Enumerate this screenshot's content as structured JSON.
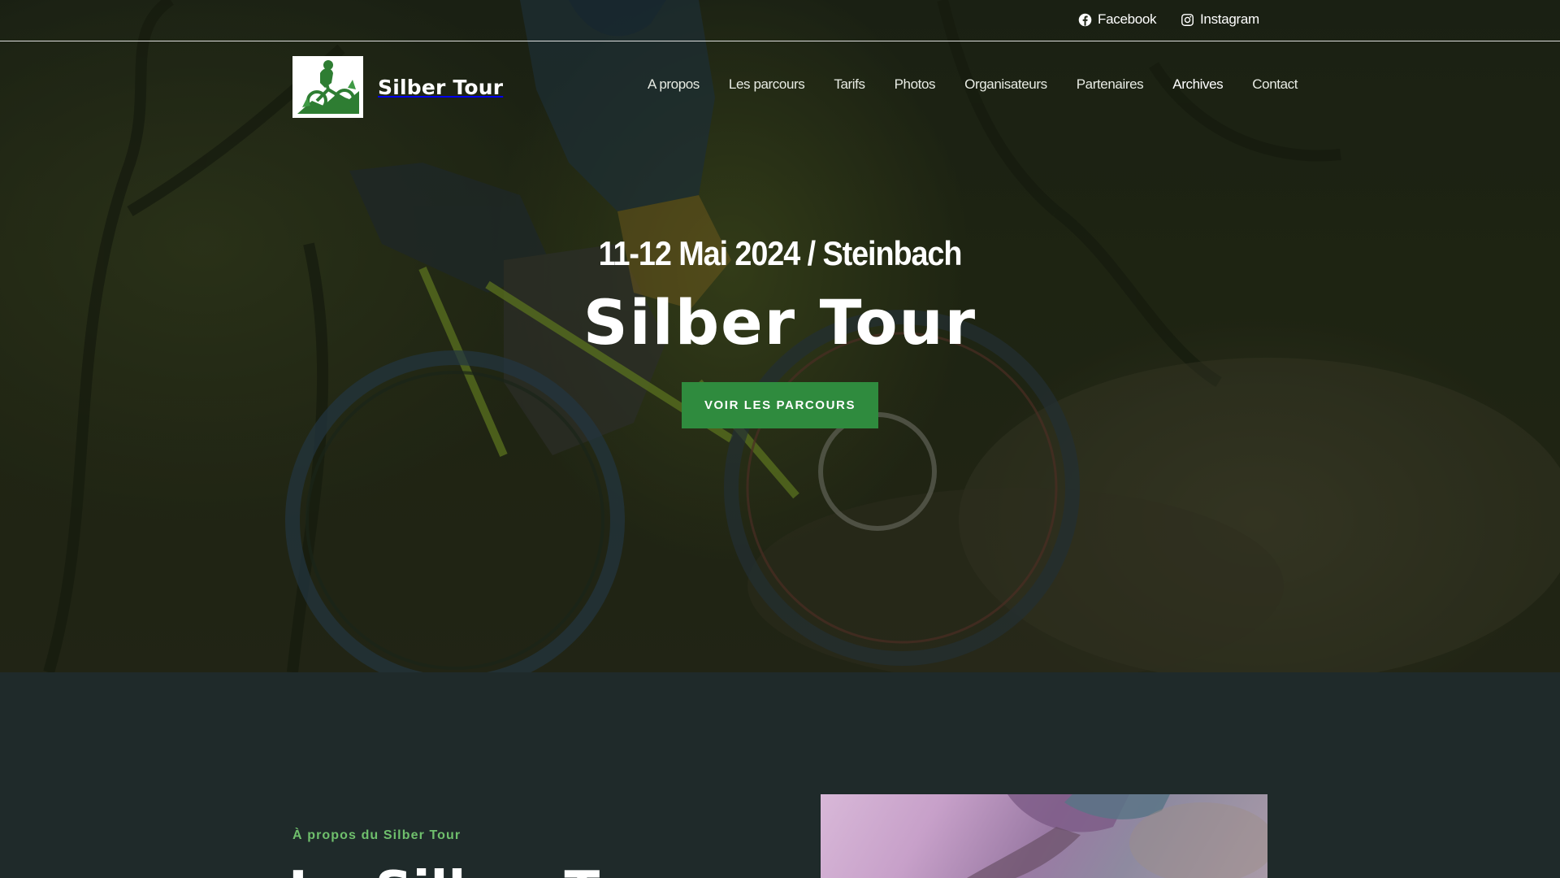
{
  "social": {
    "facebook": {
      "label": "Facebook",
      "icon": "facebook-icon"
    },
    "instagram": {
      "label": "Instagram",
      "icon": "instagram-icon"
    }
  },
  "brand": {
    "name": "Silber Tour",
    "logo_icon": "mountain-biker-logo"
  },
  "nav": {
    "items": [
      {
        "label": "A propos"
      },
      {
        "label": "Les parcours"
      },
      {
        "label": "Tarifs"
      },
      {
        "label": "Photos"
      },
      {
        "label": "Organisateurs"
      },
      {
        "label": "Partenaires"
      },
      {
        "label": "Archives"
      },
      {
        "label": "Contact"
      }
    ],
    "active": "Archives"
  },
  "hero": {
    "date_location": "11-12 Mai 2024 / Steinbach",
    "title": "Silber Tour",
    "cta_label": "VOIR LES PARCOURS"
  },
  "about": {
    "kicker": "À propos du Silber Tour",
    "heading": "Le Silber Tour"
  },
  "colors": {
    "accent_green": "#2f8b3e",
    "kicker_green": "#6fbf6c",
    "section_bg": "#1f2a2a"
  }
}
